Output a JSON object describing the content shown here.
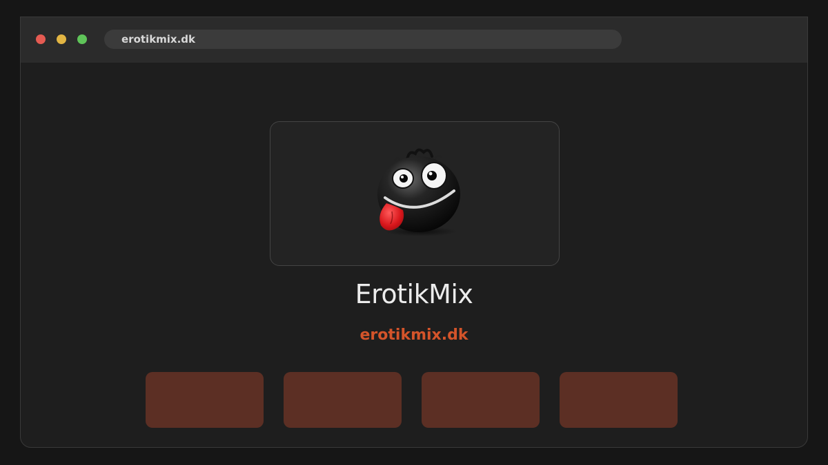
{
  "browser": {
    "url": "erotikmix.dk",
    "window_controls": [
      "close",
      "minimize",
      "maximize"
    ]
  },
  "site": {
    "logo_icon": "smiley-tongue-icon",
    "title": "ErotikMix",
    "domain": "erotikmix.dk"
  },
  "tiles": [
    {
      "label": ""
    },
    {
      "label": ""
    },
    {
      "label": ""
    },
    {
      "label": ""
    }
  ],
  "colors": {
    "background": "#161616",
    "window": "#1e1e1e",
    "titlebar": "#2b2b2b",
    "accent": "#d4542a",
    "tile": "#5c2f24"
  }
}
